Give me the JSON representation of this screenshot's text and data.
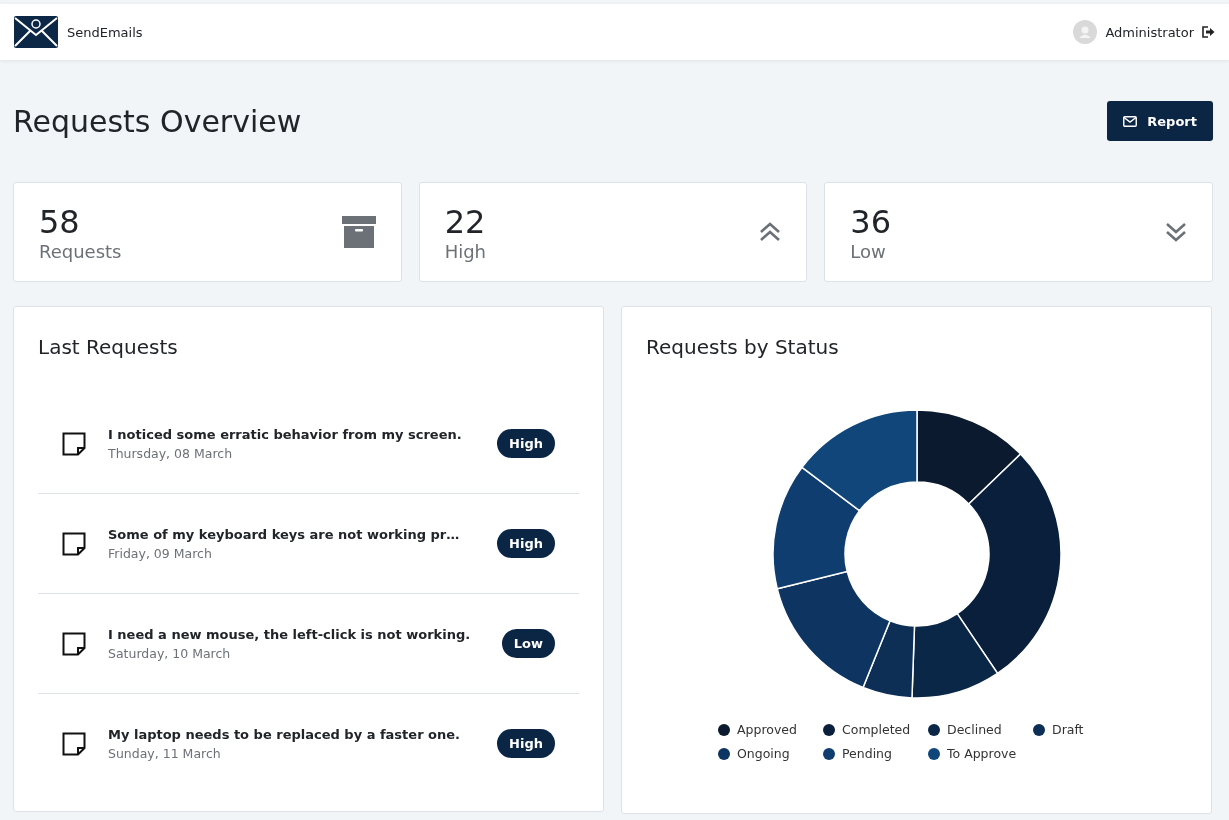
{
  "header": {
    "brand": "SendEmails",
    "user": "Administrator"
  },
  "page": {
    "title": "Requests Overview",
    "report_button": "Report"
  },
  "stats": [
    {
      "value": "58",
      "label": "Requests",
      "kind": "archive"
    },
    {
      "value": "22",
      "label": "High",
      "kind": "up"
    },
    {
      "value": "36",
      "label": "Low",
      "kind": "down"
    }
  ],
  "last_requests": {
    "title": "Last Requests",
    "items": [
      {
        "text": "I noticed some erratic behavior from my screen.",
        "date": "Thursday, 08 March",
        "priority": "High"
      },
      {
        "text": "Some of my keyboard keys are not working pr…",
        "date": "Friday, 09 March",
        "priority": "High"
      },
      {
        "text": "I need a new mouse, the left-click is not working.",
        "date": "Saturday, 10 March",
        "priority": "Low"
      },
      {
        "text": "My laptop needs to be replaced by a faster one.",
        "date": "Sunday, 11 March",
        "priority": "High"
      }
    ]
  },
  "status_chart": {
    "title": "Requests by Status",
    "legend": [
      {
        "label": "Approved",
        "color": "#0b1a2e"
      },
      {
        "label": "Completed",
        "color": "#0a1f3b"
      },
      {
        "label": "Declined",
        "color": "#0b2748"
      },
      {
        "label": "Draft",
        "color": "#0d2e55"
      },
      {
        "label": "Ongoing",
        "color": "#0e3461"
      },
      {
        "label": "Pending",
        "color": "#0f3d6f"
      },
      {
        "label": "To Approve",
        "color": "#104679"
      }
    ]
  }
}
